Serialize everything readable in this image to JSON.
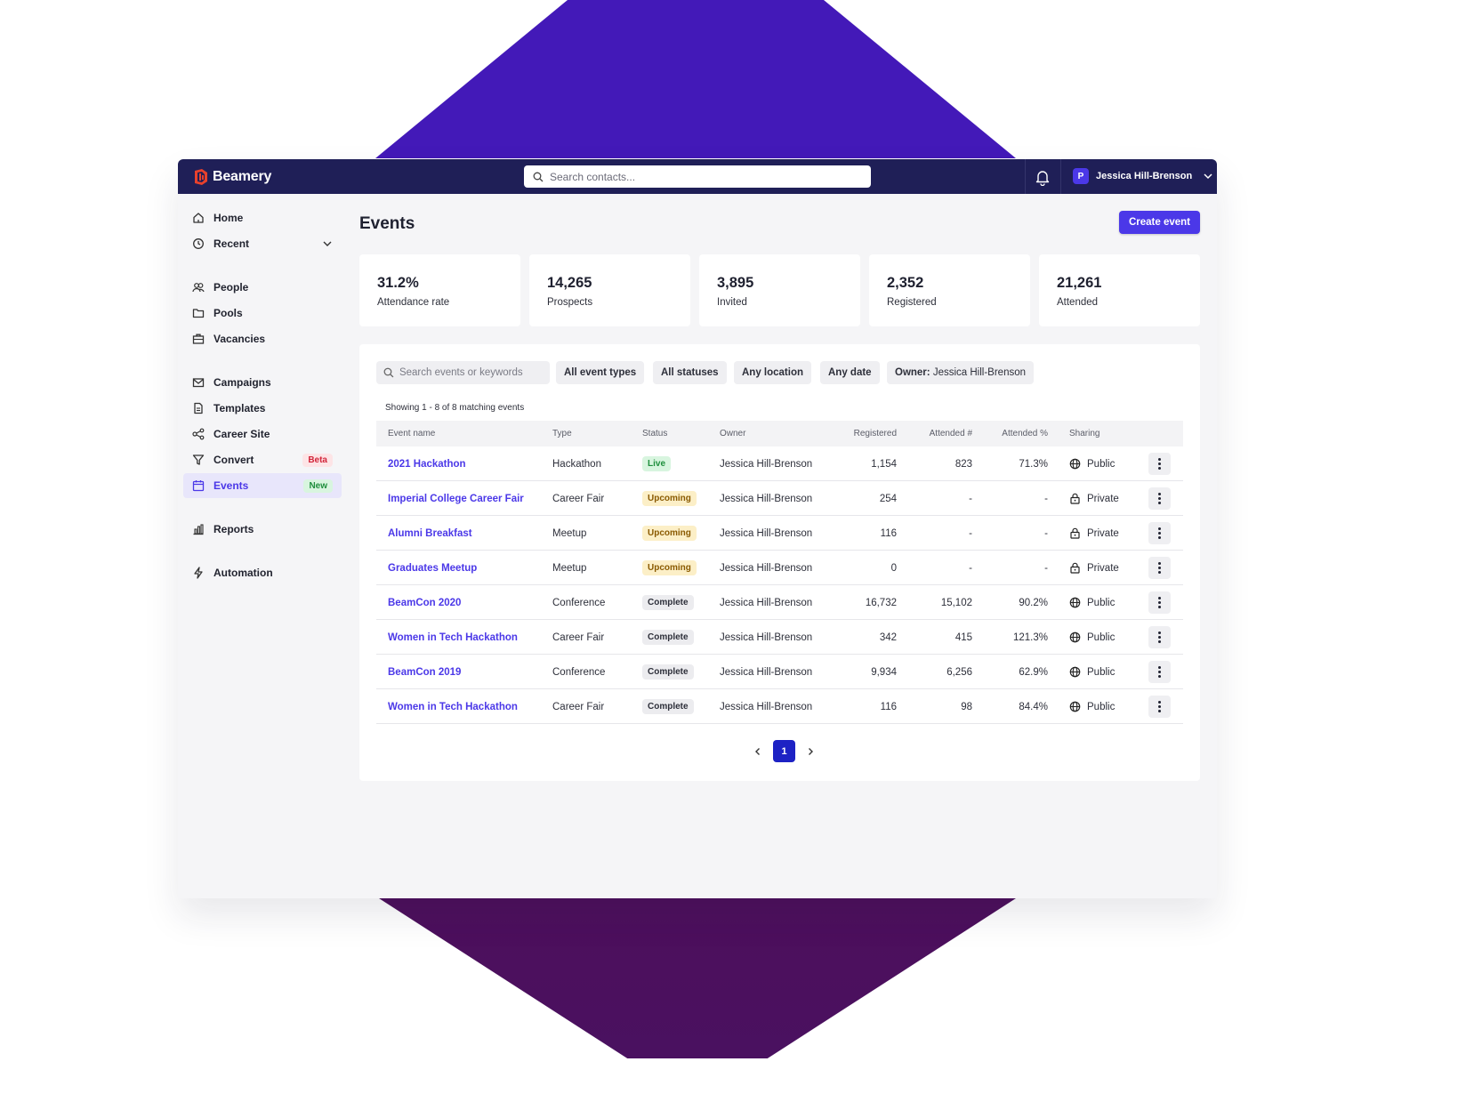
{
  "app": {
    "brand": "Beamery",
    "search_placeholder": "Search contacts...",
    "user": {
      "initial": "P",
      "name": "Jessica Hill-Brenson"
    },
    "colors": {
      "topbar": "#1f1f57",
      "accent": "#4b38e8",
      "background_shape": "#4319b8"
    }
  },
  "sidebar": {
    "items": [
      {
        "label": "Home",
        "icon": "home-icon"
      },
      {
        "label": "Recent",
        "icon": "clock-icon",
        "expandable": true
      },
      {
        "label": "People",
        "icon": "people-icon"
      },
      {
        "label": "Pools",
        "icon": "folder-icon"
      },
      {
        "label": "Vacancies",
        "icon": "briefcase-icon"
      },
      {
        "label": "Campaigns",
        "icon": "mail-icon"
      },
      {
        "label": "Templates",
        "icon": "document-icon"
      },
      {
        "label": "Career Site",
        "icon": "network-icon"
      },
      {
        "label": "Convert",
        "icon": "filter-icon",
        "badge": "Beta"
      },
      {
        "label": "Events",
        "icon": "calendar-icon",
        "badge": "New",
        "active": true
      },
      {
        "label": "Reports",
        "icon": "bar-chart-icon"
      },
      {
        "label": "Automation",
        "icon": "lightning-icon"
      }
    ],
    "collapse_icon": "double-chevron-left-icon"
  },
  "main": {
    "title": "Events",
    "create_button": "Create event",
    "stats": [
      {
        "value": "31.2%",
        "label": "Attendance rate"
      },
      {
        "value": "14,265",
        "label": "Prospects"
      },
      {
        "value": "3,895",
        "label": "Invited"
      },
      {
        "value": "2,352",
        "label": "Registered"
      },
      {
        "value": "21,261",
        "label": "Attended"
      }
    ],
    "filters": {
      "search_placeholder": "Search events or keywords",
      "event_types": "All event types",
      "statuses": "All statuses",
      "location": "Any location",
      "date": "Any date",
      "owner_label": "Owner:",
      "owner_value": "Jessica Hill-Brenson"
    },
    "showing": "Showing 1 - 8 of 8 matching events",
    "table": {
      "columns": [
        "Event name",
        "Type",
        "Status",
        "Owner",
        "Registered",
        "Attended #",
        "Attended %",
        "Sharing"
      ],
      "rows": [
        {
          "name": "2021 Hackathon",
          "type": "Hackathon",
          "status": "Live",
          "owner": "Jessica Hill-Brenson",
          "registered": "1,154",
          "attended": "823",
          "attended_pct": "71.3%",
          "sharing": "Public"
        },
        {
          "name": "Imperial College Career Fair",
          "type": "Career Fair",
          "status": "Upcoming",
          "owner": "Jessica Hill-Brenson",
          "registered": "254",
          "attended": "-",
          "attended_pct": "-",
          "sharing": "Private"
        },
        {
          "name": "Alumni Breakfast",
          "type": "Meetup",
          "status": "Upcoming",
          "owner": "Jessica Hill-Brenson",
          "registered": "116",
          "attended": "-",
          "attended_pct": "-",
          "sharing": "Private"
        },
        {
          "name": "Graduates Meetup",
          "type": "Meetup",
          "status": "Upcoming",
          "owner": "Jessica Hill-Brenson",
          "registered": "0",
          "attended": "-",
          "attended_pct": "-",
          "sharing": "Private"
        },
        {
          "name": "BeamCon 2020",
          "type": "Conference",
          "status": "Complete",
          "owner": "Jessica Hill-Brenson",
          "registered": "16,732",
          "attended": "15,102",
          "attended_pct": "90.2%",
          "sharing": "Public"
        },
        {
          "name": "Women in Tech Hackathon",
          "type": "Career Fair",
          "status": "Complete",
          "owner": "Jessica Hill-Brenson",
          "registered": "342",
          "attended": "415",
          "attended_pct": "121.3%",
          "sharing": "Public"
        },
        {
          "name": "BeamCon 2019",
          "type": "Conference",
          "status": "Complete",
          "owner": "Jessica Hill-Brenson",
          "registered": "9,934",
          "attended": "6,256",
          "attended_pct": "62.9%",
          "sharing": "Public"
        },
        {
          "name": "Women in Tech Hackathon",
          "type": "Career Fair",
          "status": "Complete",
          "owner": "Jessica Hill-Brenson",
          "registered": "116",
          "attended": "98",
          "attended_pct": "84.4%",
          "sharing": "Public"
        }
      ]
    },
    "pagination": {
      "current_page": "1"
    }
  }
}
